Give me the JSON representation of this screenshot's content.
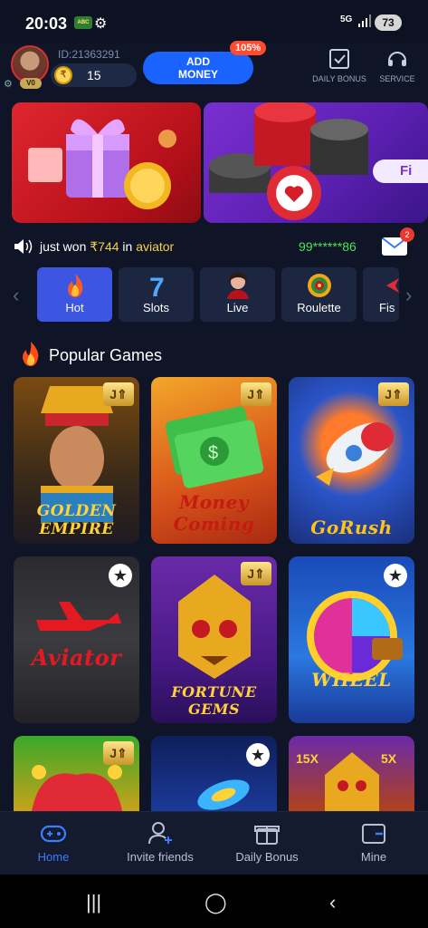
{
  "status_bar": {
    "time": "20:03",
    "carrier_badge": "ABC",
    "network": "5G",
    "battery": "73"
  },
  "header": {
    "vip_level": "V0",
    "user_id": "ID:21363291",
    "balance": "15",
    "add_money_label": "ADD MONEY",
    "promo_badge": "105%",
    "daily_bonus_label": "DAILY BONUS",
    "service_label": "SERVICE"
  },
  "banners": [
    {
      "theme": "gift-box-coins"
    },
    {
      "theme": "poker-chips",
      "button_label": "Fi"
    }
  ],
  "ticker": {
    "prefix": "just won ",
    "amount": "₹744",
    "middle": " in ",
    "game": "aviator",
    "user": "99******86",
    "mail_count": "2"
  },
  "categories": [
    {
      "label": "Hot",
      "icon": "fire-icon",
      "active": true
    },
    {
      "label": "Slots",
      "icon": "seven-icon",
      "active": false
    },
    {
      "label": "Live",
      "icon": "dealer-icon",
      "active": false
    },
    {
      "label": "Roulette",
      "icon": "roulette-icon",
      "active": false
    },
    {
      "label": "Fis",
      "icon": "fish-icon",
      "active": false
    }
  ],
  "popular": {
    "title": "Popular Games",
    "games": [
      {
        "name": "GOLDEN EMPIRE",
        "badge": "J"
      },
      {
        "name": "Money Coming",
        "badge": "J"
      },
      {
        "name": "GoRush",
        "badge": "J"
      },
      {
        "name": "Aviator",
        "badge": "star"
      },
      {
        "name": "FORTUNE GEMS",
        "badge": "J"
      },
      {
        "name": "WHEEL",
        "badge": "star"
      },
      {
        "name": "",
        "badge": "J"
      },
      {
        "name": "",
        "badge": "star"
      },
      {
        "name": "",
        "badge": ""
      }
    ]
  },
  "bottom_nav": [
    {
      "label": "Home",
      "icon": "gamepad-icon",
      "active": true
    },
    {
      "label": "Invite friends",
      "icon": "add-user-icon",
      "active": false
    },
    {
      "label": "Daily Bonus",
      "icon": "gift-icon",
      "active": false
    },
    {
      "label": "Mine",
      "icon": "wallet-icon",
      "active": false
    }
  ],
  "colors": {
    "background": "#0f1526",
    "accent_blue": "#1a63ff",
    "active_category": "#3d56e2",
    "win_amount": "#f7d046",
    "winner_user": "#47e35a"
  }
}
